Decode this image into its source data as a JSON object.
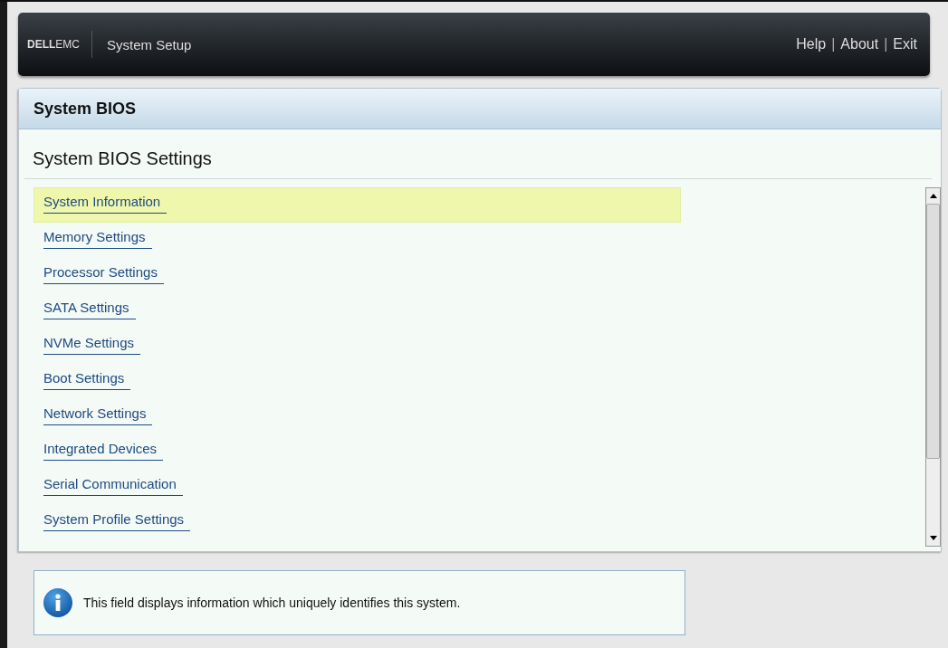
{
  "header": {
    "logo": {
      "brand": "DELL",
      "suffix": "EMC"
    },
    "title": "System Setup",
    "links": [
      "Help",
      "About",
      "Exit"
    ],
    "separator": "|"
  },
  "panel": {
    "title": "System BIOS",
    "subtitle": "System BIOS Settings",
    "items": [
      {
        "label": "System Information",
        "selected": true
      },
      {
        "label": "Memory Settings",
        "selected": false
      },
      {
        "label": "Processor Settings",
        "selected": false
      },
      {
        "label": "SATA Settings",
        "selected": false
      },
      {
        "label": "NVMe Settings",
        "selected": false
      },
      {
        "label": "Boot Settings",
        "selected": false
      },
      {
        "label": "Network Settings",
        "selected": false
      },
      {
        "label": "Integrated Devices",
        "selected": false
      },
      {
        "label": "Serial Communication",
        "selected": false
      },
      {
        "label": "System Profile Settings",
        "selected": false
      }
    ]
  },
  "help": {
    "text": "This field displays information which uniquely identifies this system."
  }
}
